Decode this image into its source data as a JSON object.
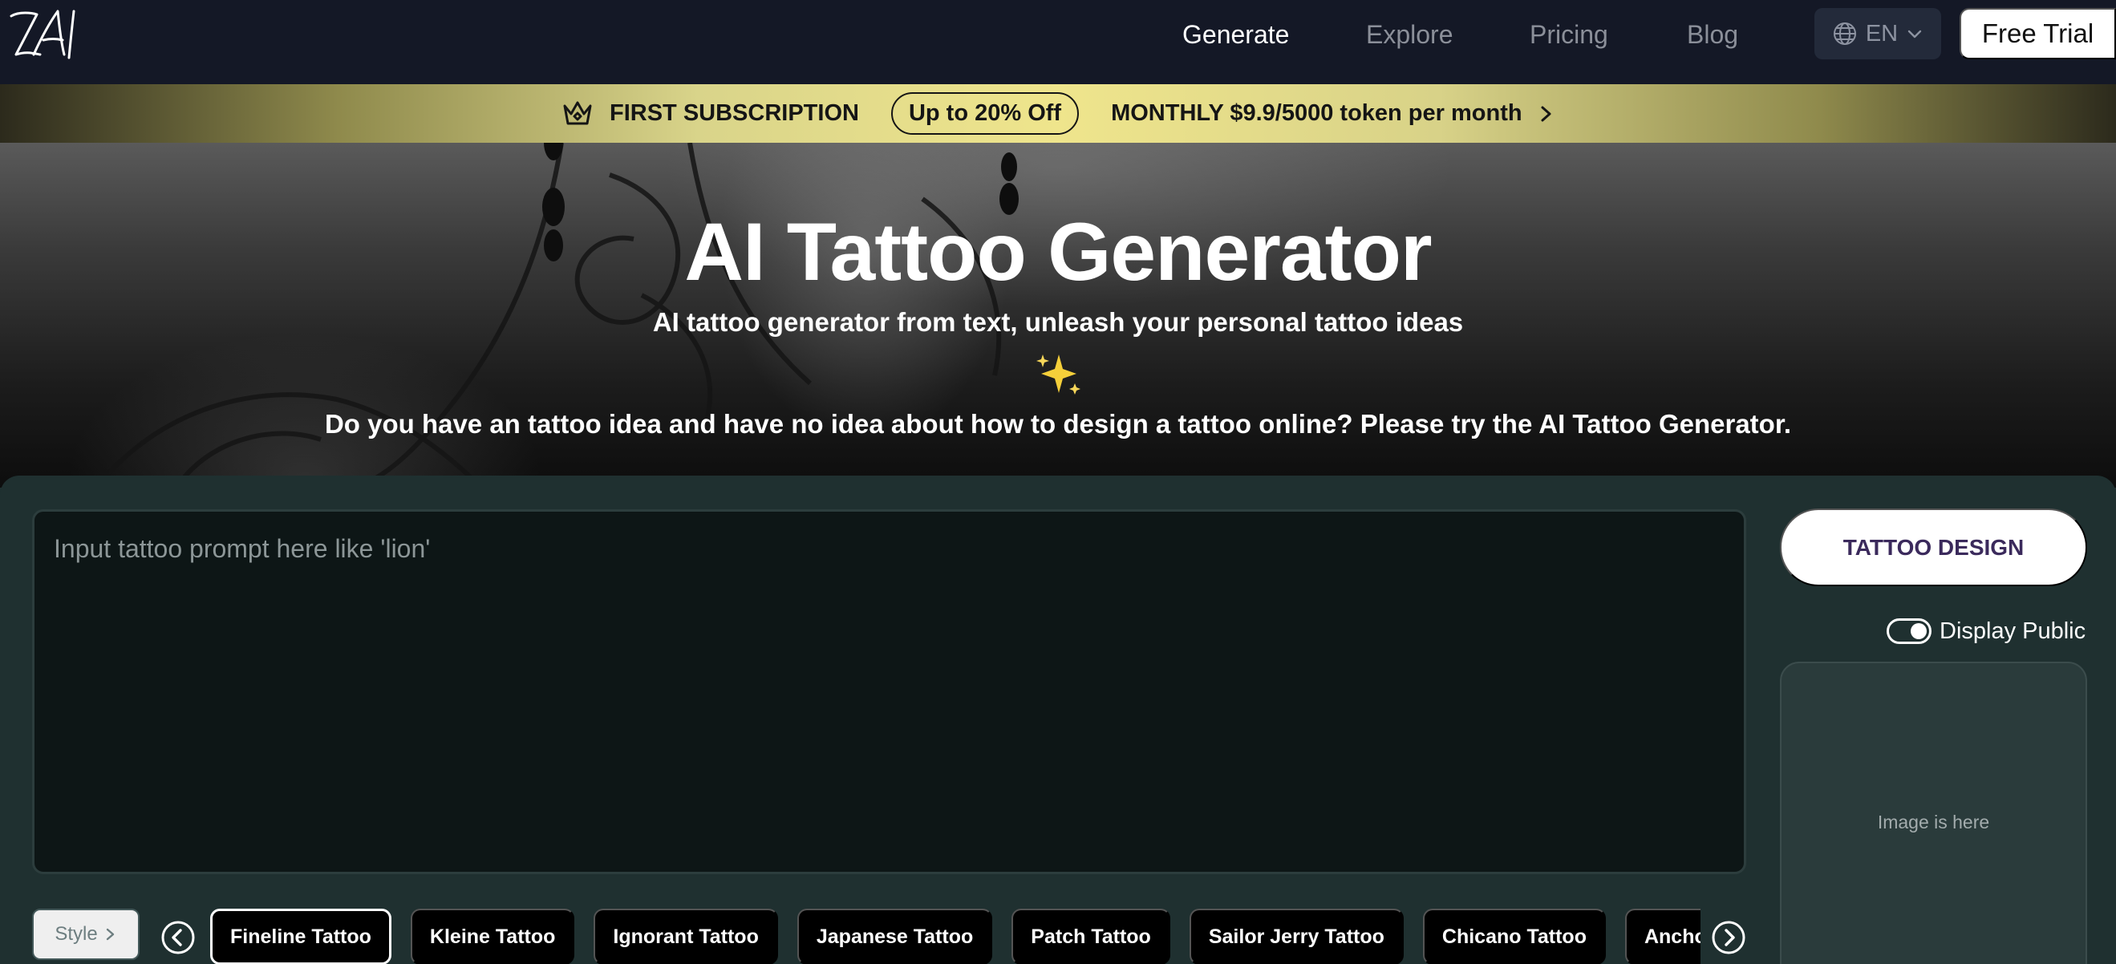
{
  "nav": {
    "logo_text": "ZAI",
    "links": [
      {
        "label": "Generate",
        "active": true
      },
      {
        "label": "Explore",
        "active": false
      },
      {
        "label": "Pricing",
        "active": false
      },
      {
        "label": "Blog",
        "active": false
      }
    ],
    "language": "EN",
    "cta": "Free Trial"
  },
  "promo": {
    "title": "FIRST SUBSCRIPTION",
    "badge": "Up to 20% Off",
    "offer": "MONTHLY $9.9/5000 token per month"
  },
  "hero": {
    "title": "AI Tattoo Generator",
    "subtitle": "AI tattoo generator from text, unleash your personal tattoo ideas",
    "description": "Do you have an tattoo idea and have no idea about how to design a tattoo online? Please try the AI Tattoo Generator."
  },
  "generator": {
    "prompt_placeholder": "Input tattoo prompt here like 'lion'",
    "prompt_value": "",
    "submit_label": "TATTOO DESIGN",
    "public_toggle_label": "Display Public",
    "public_toggle_on": true,
    "image_placeholder": "Image is here",
    "style_label": "Style",
    "styles": [
      {
        "label": "Fineline Tattoo",
        "selected": true
      },
      {
        "label": "Kleine Tattoo",
        "selected": false
      },
      {
        "label": "Ignorant Tattoo",
        "selected": false
      },
      {
        "label": "Japanese Tattoo",
        "selected": false
      },
      {
        "label": "Patch Tattoo",
        "selected": false
      },
      {
        "label": "Sailor Jerry Tattoo",
        "selected": false
      },
      {
        "label": "Chicano Tattoo",
        "selected": false
      },
      {
        "label": "Anchor Tattoo",
        "selected": false
      }
    ]
  },
  "colors": {
    "nav_bg": "#141826",
    "panel_bg": "#1f3030",
    "promo_gold": "#efe58c",
    "button_text": "#3b2a5c"
  },
  "icons": {
    "crown": "crown-icon",
    "globe": "globe-icon",
    "chevron_down": "chevron-down-icon",
    "chevron_right": "chevron-right-icon",
    "sparkles": "sparkles-icon",
    "prev": "chevron-left-circle-icon",
    "next": "chevron-right-circle-icon"
  }
}
